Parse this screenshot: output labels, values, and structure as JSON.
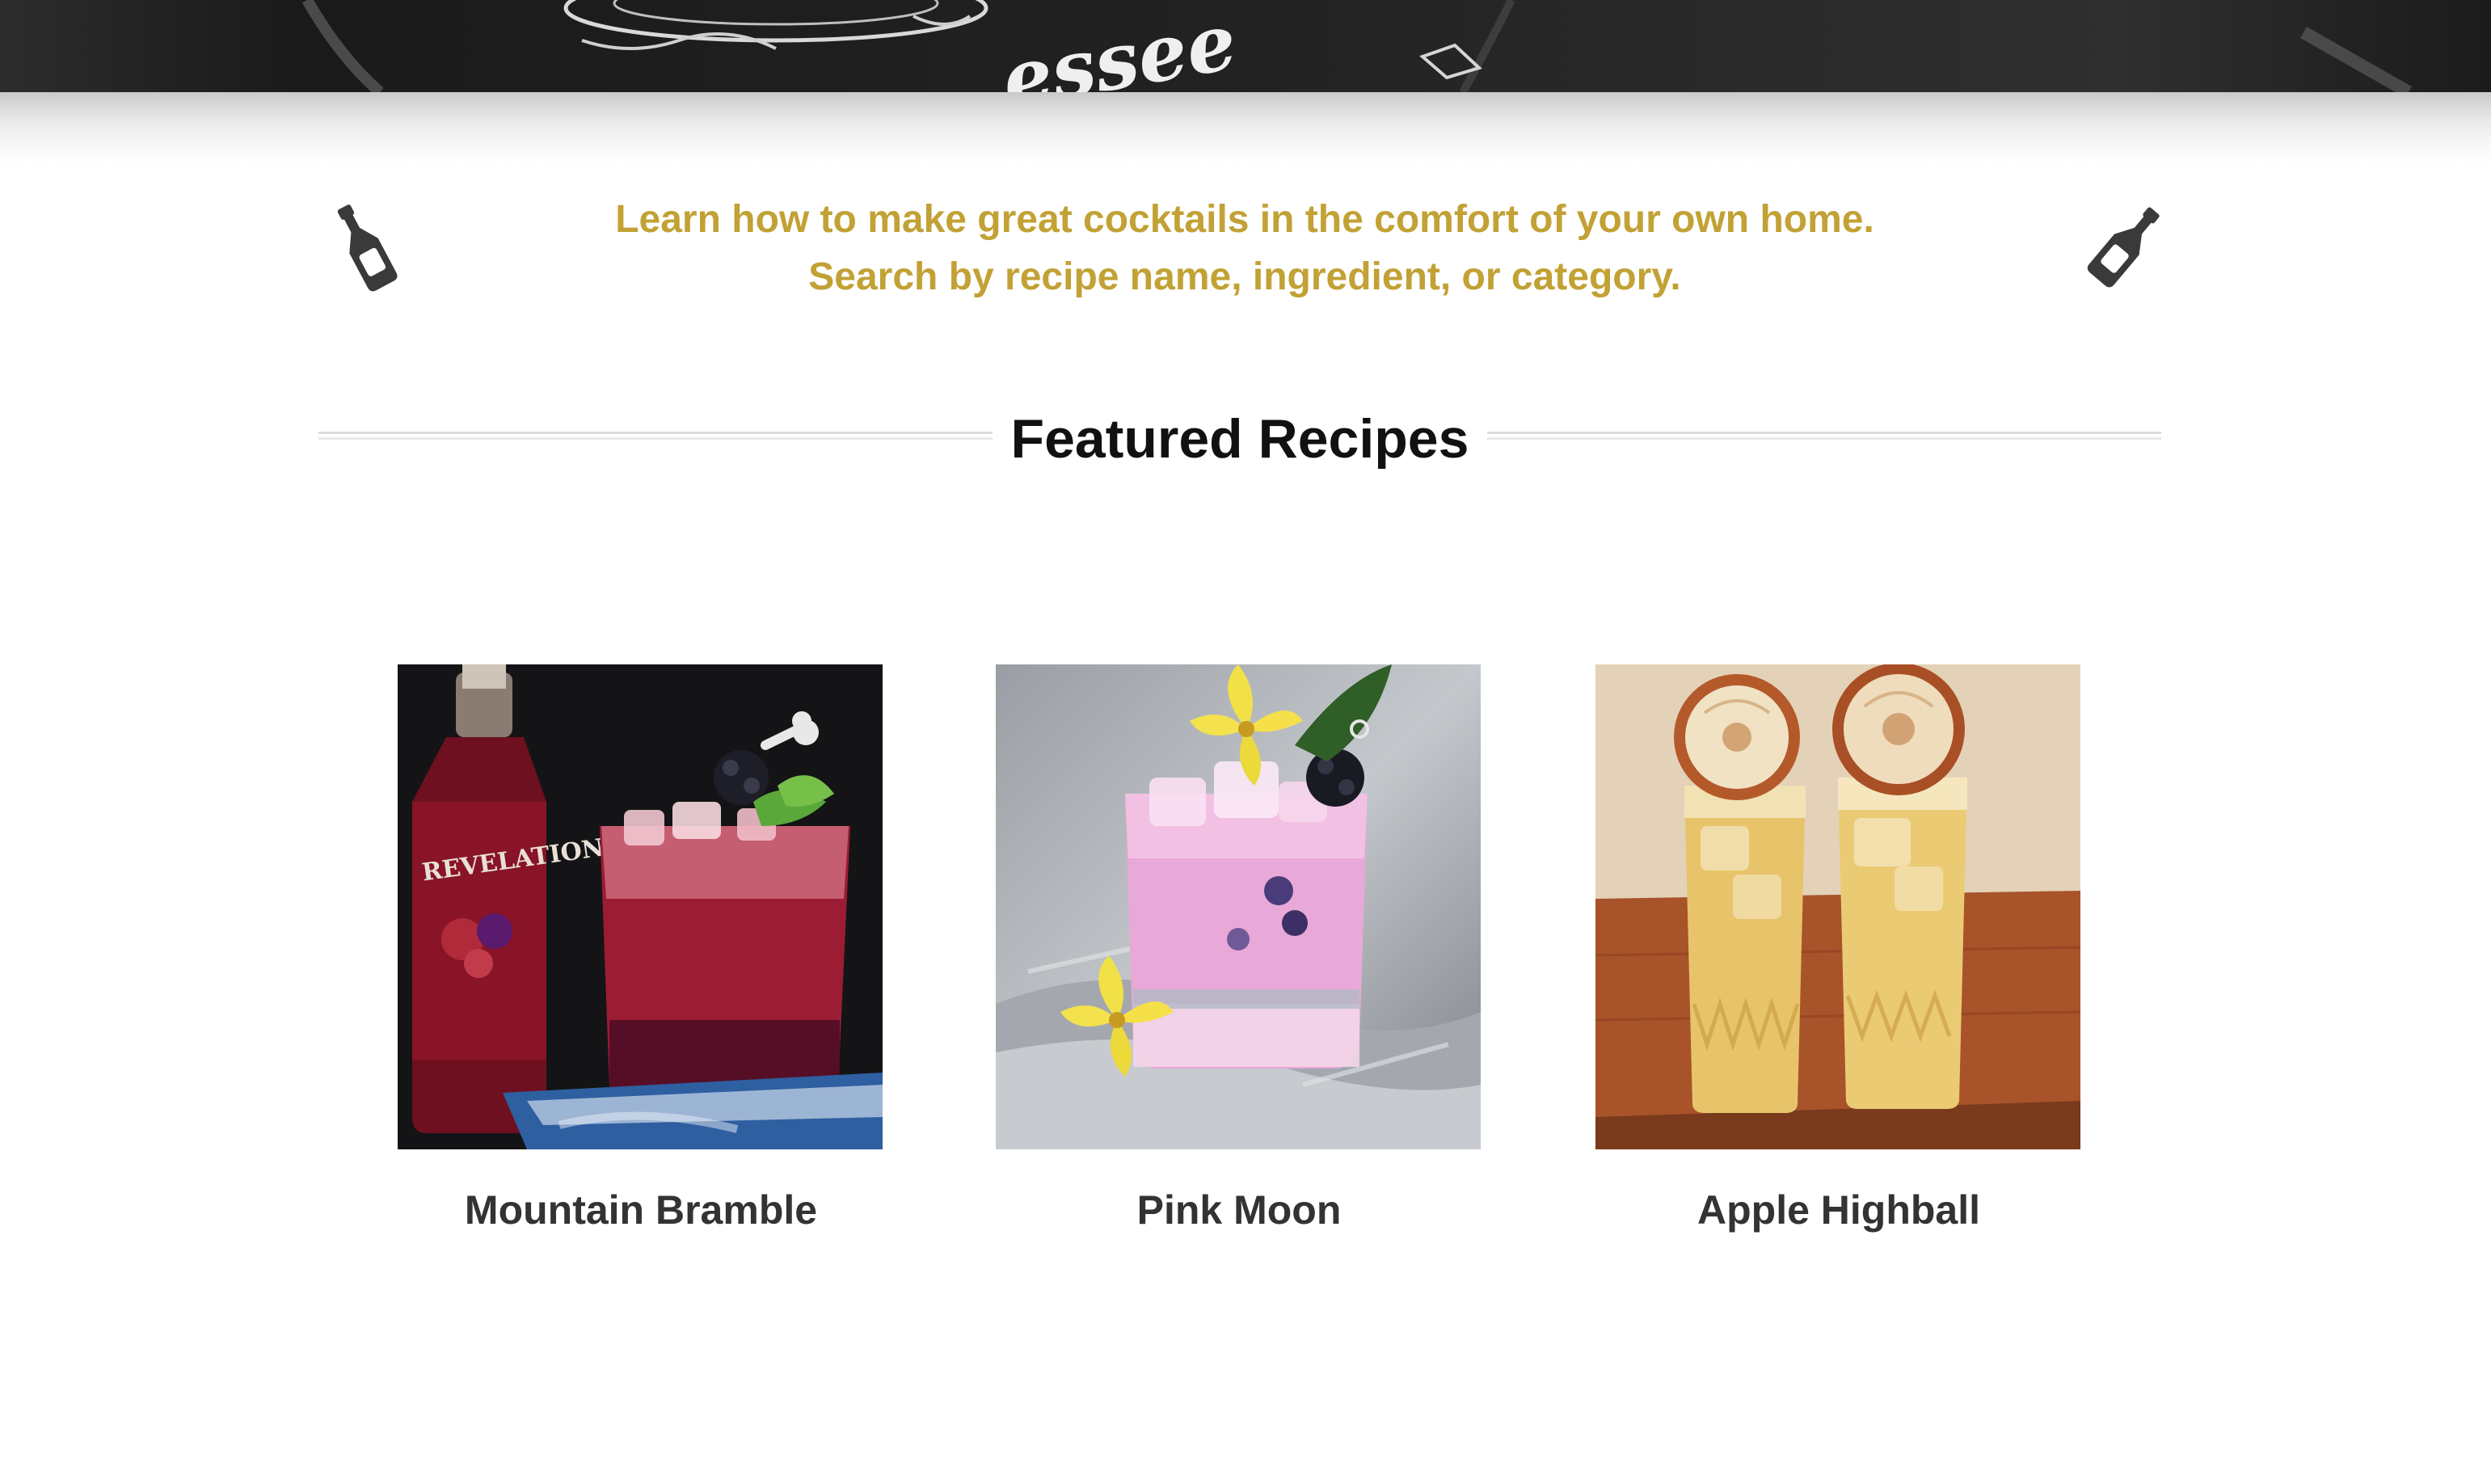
{
  "hero": {
    "banner_text": "essee"
  },
  "intro": {
    "line1": "Learn how to make great cocktails in the comfort of your own home.",
    "line2": "Search by recipe name, ingredient, or category.",
    "left_icon": "bottle-icon",
    "right_icon": "bottle-icon",
    "accent_color": "#c2a135"
  },
  "featured": {
    "title": "Featured Recipes"
  },
  "recipes": [
    {
      "title": "Mountain Bramble",
      "bottle_label": "REVELATION"
    },
    {
      "title": "Pink Moon"
    },
    {
      "title": "Apple Highball"
    }
  ]
}
